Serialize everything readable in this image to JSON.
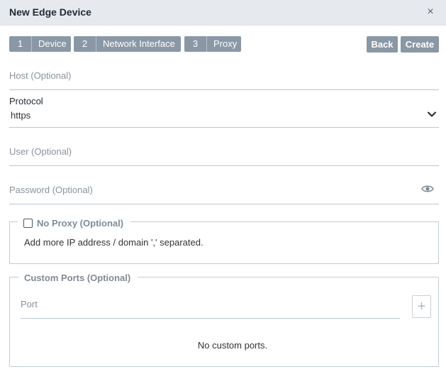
{
  "dialog": {
    "title": "New Edge Device",
    "close_icon": "×"
  },
  "steps": [
    {
      "number": "1",
      "label": "Device"
    },
    {
      "number": "2",
      "label": "Network Interface"
    },
    {
      "number": "3",
      "label": "Proxy"
    }
  ],
  "actions": {
    "back_label": "Back",
    "create_label": "Create"
  },
  "form": {
    "host_placeholder": "Host (Optional)",
    "protocol_label": "Protocol",
    "protocol_value": "https",
    "user_placeholder": "User (Optional)",
    "password_placeholder": "Password (Optional)"
  },
  "no_proxy": {
    "legend": "No Proxy (Optional)",
    "checked": false,
    "hint": "Add more IP address / domain ',' separated."
  },
  "custom_ports": {
    "legend": "Custom Ports (Optional)",
    "port_placeholder": "Port",
    "add_icon": "+",
    "empty_message": "No custom ports."
  },
  "colors": {
    "header_bg": "#e6e9ee",
    "button_bg": "#8a98a6",
    "line": "#b8c6ce"
  }
}
